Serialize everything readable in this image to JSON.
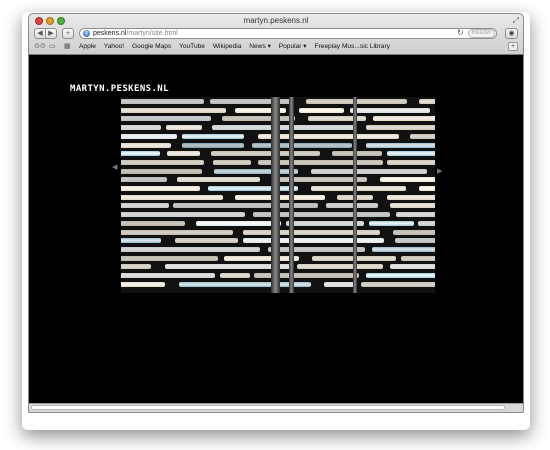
{
  "window": {
    "title": "martyn.peskens.nl"
  },
  "toolbar": {
    "back_icon": "chevron-left-icon",
    "forward_icon": "chevron-right-icon",
    "new_tab_symbol": "+",
    "url_host": "peskens.nl",
    "url_path": "/martyn/site.html",
    "reload_symbol": "↻",
    "reader_label": "Reader",
    "action_symbol": "◉"
  },
  "bookmarks": {
    "items": [
      "Apple",
      "Yahoo!",
      "Google Maps",
      "YouTube",
      "Wikipedia",
      "News ▾",
      "Popular ▾",
      "Freeplay Mus...sic Library"
    ],
    "add_symbol": "+"
  },
  "site": {
    "logo": "MARTYN.PESKENS.NL",
    "prev_arrow": "◀",
    "next_arrow": "▶"
  },
  "colors": {
    "tube_warm": "#f3e6c8",
    "tube_white": "#e9eef3",
    "tube_blue": "#9fd4ea",
    "background": "#000000"
  }
}
